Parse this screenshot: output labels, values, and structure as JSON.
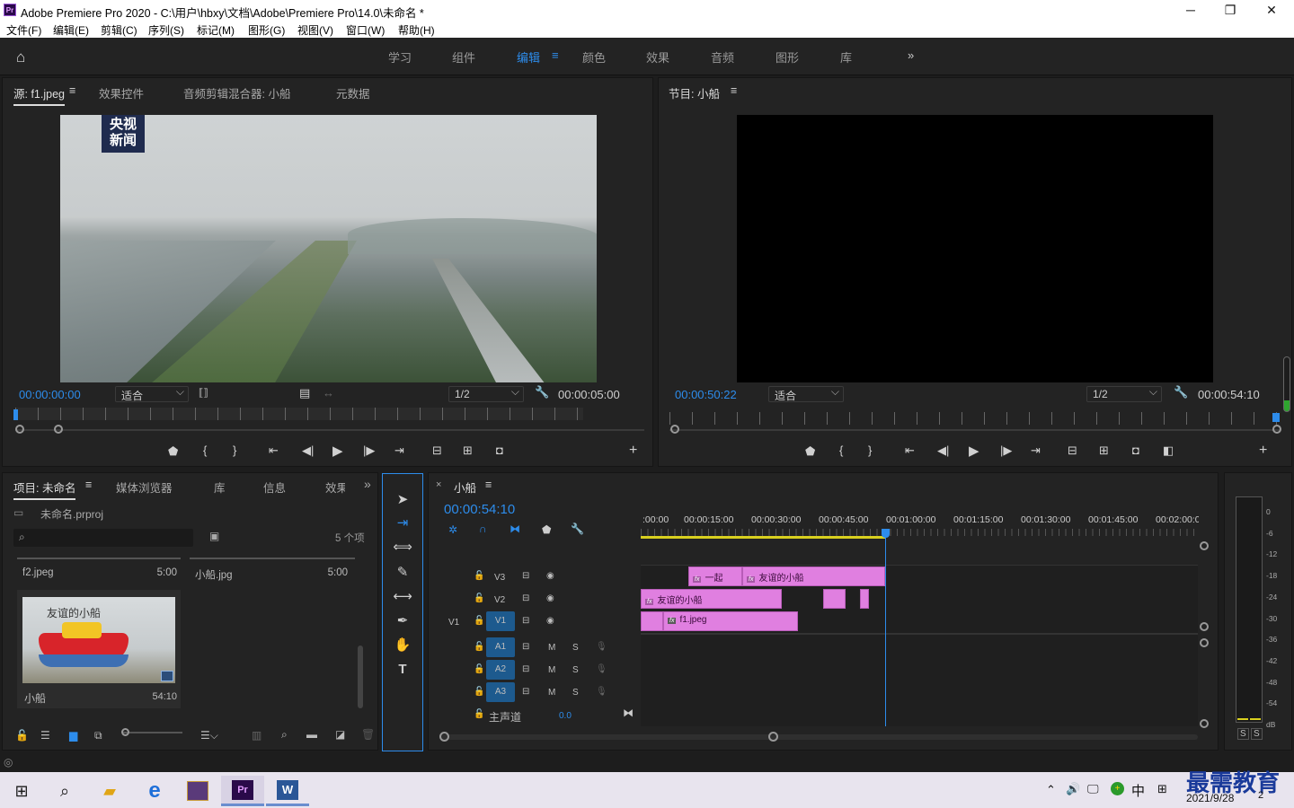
{
  "window": {
    "title": "Adobe Premiere Pro 2020 - C:\\用户\\hbxy\\文档\\Adobe\\Premiere Pro\\14.0\\未命名 *",
    "app_badge": "Pr",
    "minimize": "─",
    "maximize": "❐",
    "close": "✕"
  },
  "menu": [
    "文件(F)",
    "编辑(E)",
    "剪辑(C)",
    "序列(S)",
    "标记(M)",
    "图形(G)",
    "视图(V)",
    "窗口(W)",
    "帮助(H)"
  ],
  "workspaces": {
    "tabs": [
      "学习",
      "组件",
      "编辑",
      "颜色",
      "效果",
      "音频",
      "图形",
      "库"
    ],
    "active": "编辑",
    "more": "»"
  },
  "source": {
    "tabs": [
      "源: f1.jpeg",
      "效果控件",
      "音频剪辑混合器: 小船",
      "元数据"
    ],
    "timecode": "00:00:00:00",
    "fit": "适合",
    "resolution": "1/2",
    "duration": "00:00:05:00",
    "watermark": [
      "央视",
      "新闻"
    ]
  },
  "program": {
    "title": "节目: 小船",
    "timecode": "00:00:50:22",
    "fit": "适合",
    "resolution": "1/2",
    "duration": "00:00:54:10"
  },
  "project": {
    "tabs": [
      "项目: 未命名",
      "媒体浏览器",
      "库",
      "信息",
      "效果"
    ],
    "file": "未命名.prproj",
    "count": "5 个项",
    "items": [
      {
        "name": "f2.jpeg",
        "dur": "5:00"
      },
      {
        "name": "小船.jpg",
        "dur": "5:00"
      },
      {
        "name": "小船",
        "dur": "54:10",
        "thumb_text": "友谊的小船"
      }
    ]
  },
  "timeline": {
    "title": "小船",
    "timecode": "00:00:54:10",
    "ruler": [
      ":00:00",
      "00:00:15:00",
      "00:00:30:00",
      "00:00:45:00",
      "00:01:00:00",
      "00:01:15:00",
      "00:01:30:00",
      "00:01:45:00",
      "00:02:00:0"
    ],
    "video_tracks": [
      "V3",
      "V2",
      "V1"
    ],
    "audio_tracks": [
      "A1",
      "A2",
      "A3"
    ],
    "source_patch": "V1",
    "master": "主声道",
    "master_val": "0.0",
    "clips": {
      "v3a": "一起",
      "v3b": "友谊的小船",
      "v2a": "友谊的小船",
      "v1a": "f1.jpeg"
    },
    "fx": "fx"
  },
  "meter": {
    "scale": [
      "0",
      "-6",
      "-12",
      "-18",
      "-24",
      "-30",
      "-36",
      "-42",
      "-48",
      "-54",
      "dB"
    ],
    "solo": [
      "S",
      "S"
    ]
  },
  "taskbar": {
    "clock_date": "2021/9/28",
    "ime": "中",
    "watermark": "最需教育",
    "notif": "2"
  }
}
